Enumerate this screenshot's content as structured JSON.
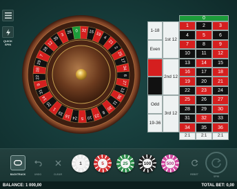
{
  "side": {
    "quick_spin_label": "QUICK SPIN"
  },
  "wheel": {
    "sequence": [
      "0",
      "32",
      "15",
      "19",
      "4",
      "21",
      "2",
      "25",
      "17",
      "34",
      "6",
      "27",
      "13",
      "36",
      "11",
      "30",
      "8",
      "23",
      "10",
      "5",
      "24",
      "16",
      "33",
      "1",
      "20",
      "14",
      "31",
      "9",
      "22",
      "18",
      "29",
      "7",
      "28",
      "12",
      "35",
      "3",
      "26"
    ],
    "red_numbers": [
      "1",
      "3",
      "5",
      "7",
      "9",
      "12",
      "14",
      "16",
      "18",
      "19",
      "21",
      "23",
      "25",
      "27",
      "30",
      "32",
      "34",
      "36"
    ]
  },
  "table": {
    "zero": "0",
    "rows": [
      [
        "1",
        "2",
        "3"
      ],
      [
        "4",
        "5",
        "6"
      ],
      [
        "7",
        "8",
        "9"
      ],
      [
        "10",
        "11",
        "12"
      ],
      [
        "13",
        "14",
        "15"
      ],
      [
        "16",
        "17",
        "18"
      ],
      [
        "19",
        "20",
        "21"
      ],
      [
        "22",
        "23",
        "24"
      ],
      [
        "25",
        "26",
        "27"
      ],
      [
        "28",
        "29",
        "30"
      ],
      [
        "31",
        "32",
        "33"
      ],
      [
        "34",
        "35",
        "36"
      ]
    ],
    "dozens": [
      "1st 12",
      "2nd 12",
      "3rd 12"
    ],
    "outside": [
      "1-18",
      "Even",
      "",
      "",
      "Odd",
      "19-36"
    ],
    "columns": [
      "2:1",
      "2:1",
      "2:1"
    ],
    "colors": {
      "red": "#d51f1f",
      "black": "#111111",
      "green": "#1c9b3a"
    }
  },
  "controls": {
    "backtrack_label": "BACKTRACK",
    "undo_label": "UNDO",
    "clear_label": "CLEAR",
    "rebet_label": "REBET",
    "spin_label": "SPIN"
  },
  "chips": [
    {
      "value": "1",
      "color": "#e9e9e9",
      "text_color": "#333333"
    },
    {
      "value": "5",
      "color": "#d43232",
      "text_color": "#c0262a"
    },
    {
      "value": "25",
      "color": "#2c8c4a",
      "text_color": "#1f7a3d"
    },
    {
      "value": "100",
      "color": "#222222",
      "text_color": "#222222"
    },
    {
      "value": "500",
      "color": "#d14aa0",
      "text_color": "#b03585"
    }
  ],
  "status": {
    "balance": "BALANCE: 1 000,00",
    "total_bet": "TOTAL BET: 0,00"
  }
}
